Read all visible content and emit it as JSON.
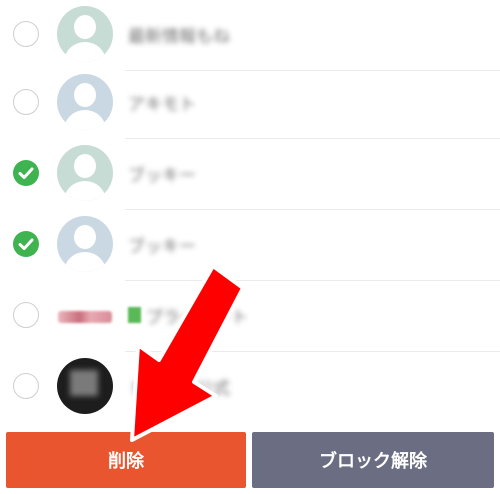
{
  "list": {
    "items": [
      {
        "name": "最新情報もね",
        "checked": false,
        "avatar": "default-person-green"
      },
      {
        "name": "アキモト",
        "checked": false,
        "avatar": "default-person-blue"
      },
      {
        "name": "ブッキー",
        "checked": true,
        "avatar": "default-person-green"
      },
      {
        "name": "ブッキー",
        "checked": true,
        "avatar": "default-person-blue"
      },
      {
        "name": "プライベート",
        "checked": false,
        "avatar": "brand-logo"
      },
      {
        "name": "トクテン公式",
        "checked": false,
        "avatar": "dark-photo"
      }
    ]
  },
  "actions": {
    "delete_label": "削除",
    "unblock_label": "ブロック解除"
  },
  "colors": {
    "check_on": "#3fb34f",
    "delete_button": "#e8552e",
    "unblock_button": "#6b6d82",
    "arrow": "#ff0000"
  }
}
